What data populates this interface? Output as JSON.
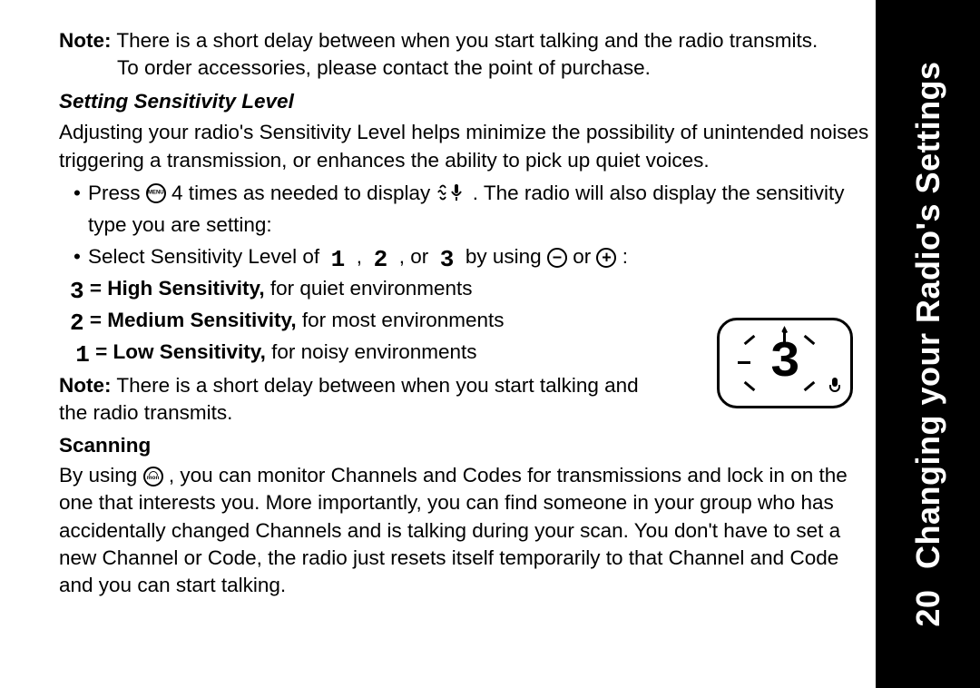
{
  "sidebar": {
    "page_number": "20",
    "title": "Changing your Radio's Settings"
  },
  "note1": {
    "label": "Note:",
    "line1": "There is a short delay between when you start talking and the radio transmits.",
    "line2": "To order accessories, please contact the point of purchase."
  },
  "section_sensitivity": {
    "heading": "Setting Sensitivity Level",
    "intro": "Adjusting your radio's Sensitivity Level helps minimize the possibility of unintended noises triggering a transmission, or enhances the ability to pick up quiet voices.",
    "bullet1_pre": "Press",
    "bullet1_mid": "4 times as needed to display",
    "bullet1_post": ". The radio will also display the sensitivity type you are setting:",
    "bullet2_pre": "Select Sensitivity Level of ",
    "bullet2_sep1": ", ",
    "bullet2_sep2": ", or ",
    "bullet2_mid": " by using",
    "bullet2_or": "or",
    "bullet2_end": ":",
    "levels": {
      "l1": "1",
      "l2": "2",
      "l3": "3"
    },
    "def3_eq": "= High Sensitivity,",
    "def3_rest": " for quiet environments",
    "def2_eq": "= Medium Sensitivity,",
    "def2_rest": " for most environments",
    "def1_eq": "= Low Sensitivity,",
    "def1_rest": " for noisy environments",
    "note2_label": "Note:",
    "note2_text": "There is a short delay between when you start talking and the radio transmits."
  },
  "section_scanning": {
    "heading": "Scanning",
    "pre": "By using",
    "body": ", you can monitor Channels and Codes for transmissions and lock in on the one that interests you. More importantly, you can find someone in your group who has accidentally changed Channels and is talking during your scan. You don't have to set a new Channel or Code, the radio just resets itself temporarily to that Channel and Code and you can start talking."
  },
  "display": {
    "value": "3"
  }
}
